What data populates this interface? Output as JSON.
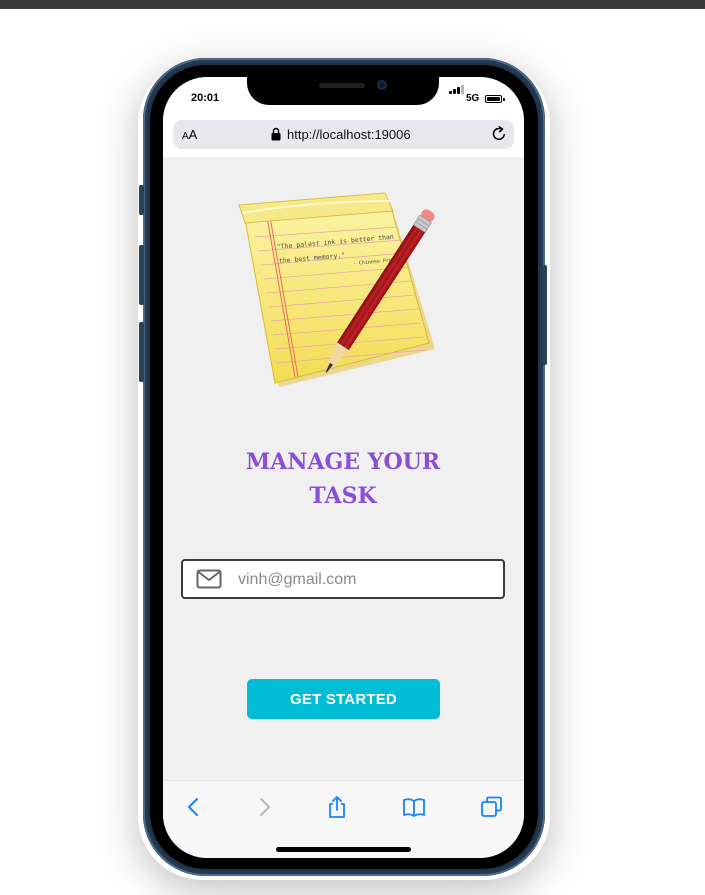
{
  "status_bar": {
    "time": "20:01",
    "network": "5G"
  },
  "browser": {
    "text_size_label_small": "A",
    "text_size_label_large": "A",
    "url": "http://localhost:19006"
  },
  "main": {
    "note_quote_line1": "\"The palest ink is better than",
    "note_quote_line2": "the best memory.\"",
    "note_attribution": "- Chinese Proverb",
    "title": "MANAGE YOUR\nTASK",
    "email_value": "vinh@gmail.com",
    "get_started_label": "GET STARTED"
  },
  "toolbar_icons": [
    "back-icon",
    "forward-icon",
    "share-icon",
    "bookmarks-icon",
    "tabs-icon"
  ],
  "colors": {
    "title": "#8a4fd6",
    "button": "#00bcd4",
    "ios_blue": "#1a82fb"
  }
}
